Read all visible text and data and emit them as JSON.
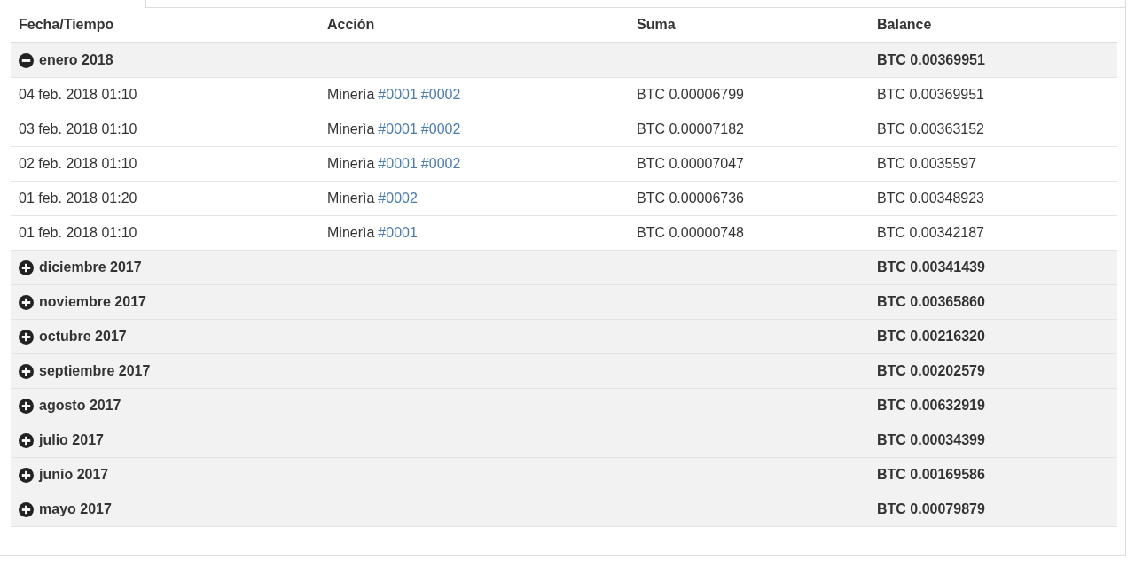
{
  "table": {
    "columns": [
      "Fecha/Tiempo",
      "Acción",
      "Suma",
      "Balance"
    ],
    "groups": [
      {
        "label": "enero 2018",
        "balance": "BTC 0.00369951",
        "expanded": true,
        "rows": [
          {
            "date": "04 feb. 2018 01:10",
            "action": "Minerìa",
            "links": [
              "#0001",
              "#0002"
            ],
            "amount": "BTC 0.00006799",
            "balance": "BTC 0.00369951"
          },
          {
            "date": "03 feb. 2018 01:10",
            "action": "Minerìa",
            "links": [
              "#0001",
              "#0002"
            ],
            "amount": "BTC 0.00007182",
            "balance": "BTC 0.00363152"
          },
          {
            "date": "02 feb. 2018 01:10",
            "action": "Minerìa",
            "links": [
              "#0001",
              "#0002"
            ],
            "amount": "BTC 0.00007047",
            "balance": "BTC 0.0035597"
          },
          {
            "date": "01 feb. 2018 01:20",
            "action": "Minerìa",
            "links": [
              "#0002"
            ],
            "amount": "BTC 0.00006736",
            "balance": "BTC 0.00348923"
          },
          {
            "date": "01 feb. 2018 01:10",
            "action": "Minerìa",
            "links": [
              "#0001"
            ],
            "amount": "BTC 0.00000748",
            "balance": "BTC 0.00342187"
          }
        ]
      },
      {
        "label": "diciembre 2017",
        "balance": "BTC 0.00341439",
        "expanded": false
      },
      {
        "label": "noviembre 2017",
        "balance": "BTC 0.00365860",
        "expanded": false
      },
      {
        "label": "octubre 2017",
        "balance": "BTC 0.00216320",
        "expanded": false
      },
      {
        "label": "septiembre 2017",
        "balance": "BTC 0.00202579",
        "expanded": false
      },
      {
        "label": "agosto 2017",
        "balance": "BTC 0.00632919",
        "expanded": false
      },
      {
        "label": "julio 2017",
        "balance": "BTC 0.00034399",
        "expanded": false
      },
      {
        "label": "junio 2017",
        "balance": "BTC 0.00169586",
        "expanded": false
      },
      {
        "label": "mayo 2017",
        "balance": "BTC 0.00079879",
        "expanded": false
      }
    ]
  }
}
